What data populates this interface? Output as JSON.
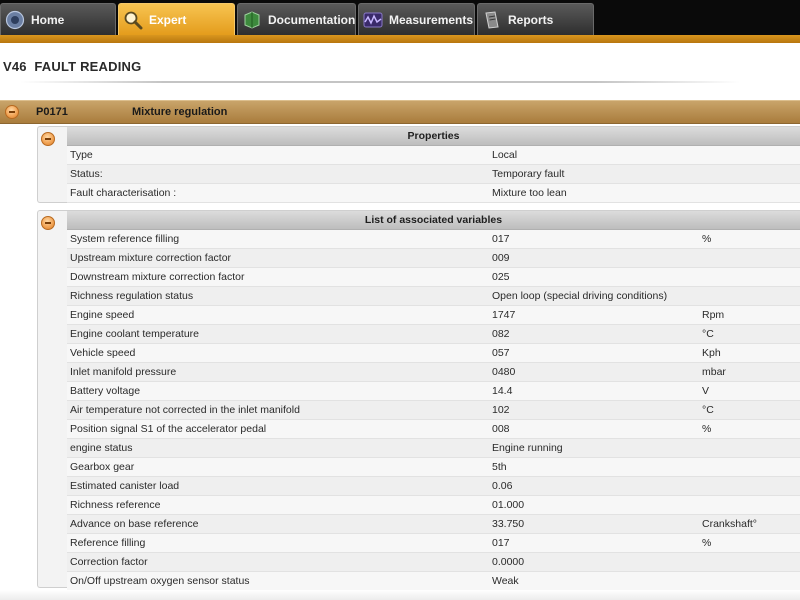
{
  "nav": {
    "tabs": [
      {
        "label": "Home",
        "icon": "home-icon",
        "active": false
      },
      {
        "label": "Expert",
        "icon": "magnifier-icon",
        "active": true
      },
      {
        "label": "Documentation",
        "icon": "book-icon",
        "active": false
      },
      {
        "label": "Measurements",
        "icon": "waveform-icon",
        "active": false
      },
      {
        "label": "Reports",
        "icon": "report-icon",
        "active": false
      }
    ]
  },
  "page": {
    "title": "V46  FAULT READING"
  },
  "fault": {
    "code": "P0171",
    "name": "Mixture regulation"
  },
  "properties": {
    "header": "Properties",
    "rows": [
      {
        "label": "Type",
        "value": "Local"
      },
      {
        "label": "Status:",
        "value": "Temporary fault"
      },
      {
        "label": "Fault characterisation :",
        "value": "Mixture too lean"
      }
    ]
  },
  "variables": {
    "header": "List of associated variables",
    "rows": [
      {
        "label": "System reference filling",
        "value": "017",
        "unit": "%"
      },
      {
        "label": "Upstream mixture correction factor",
        "value": "009",
        "unit": ""
      },
      {
        "label": "Downstream mixture correction factor",
        "value": "025",
        "unit": ""
      },
      {
        "label": "Richness regulation status",
        "value": "Open loop (special driving conditions)",
        "unit": ""
      },
      {
        "label": "Engine speed",
        "value": "1747",
        "unit": "Rpm"
      },
      {
        "label": "Engine coolant temperature",
        "value": "082",
        "unit": "°C"
      },
      {
        "label": "Vehicle speed",
        "value": "057",
        "unit": "Kph"
      },
      {
        "label": "Inlet manifold pressure",
        "value": "0480",
        "unit": "mbar"
      },
      {
        "label": "Battery voltage",
        "value": "14.4",
        "unit": "V"
      },
      {
        "label": "Air temperature not corrected in the inlet manifold",
        "value": "102",
        "unit": "°C"
      },
      {
        "label": "Position signal S1 of the accelerator pedal",
        "value": "008",
        "unit": "%"
      },
      {
        "label": "engine status",
        "value": "Engine running",
        "unit": ""
      },
      {
        "label": "Gearbox gear",
        "value": "5th",
        "unit": ""
      },
      {
        "label": "Estimated canister load",
        "value": "0.06",
        "unit": ""
      },
      {
        "label": "Richness reference",
        "value": "01.000",
        "unit": ""
      },
      {
        "label": "Advance on base reference",
        "value": "33.750",
        "unit": "Crankshaft°"
      },
      {
        "label": "Reference filling",
        "value": "017",
        "unit": "%"
      },
      {
        "label": "Correction factor",
        "value": "0.0000",
        "unit": ""
      },
      {
        "label": "On/Off upstream oxygen sensor status",
        "value": "Weak",
        "unit": ""
      }
    ]
  },
  "colors": {
    "accent_orange": "#e49c1c",
    "fault_bar": "#b88a48",
    "topbar": "#0a0a0a"
  }
}
